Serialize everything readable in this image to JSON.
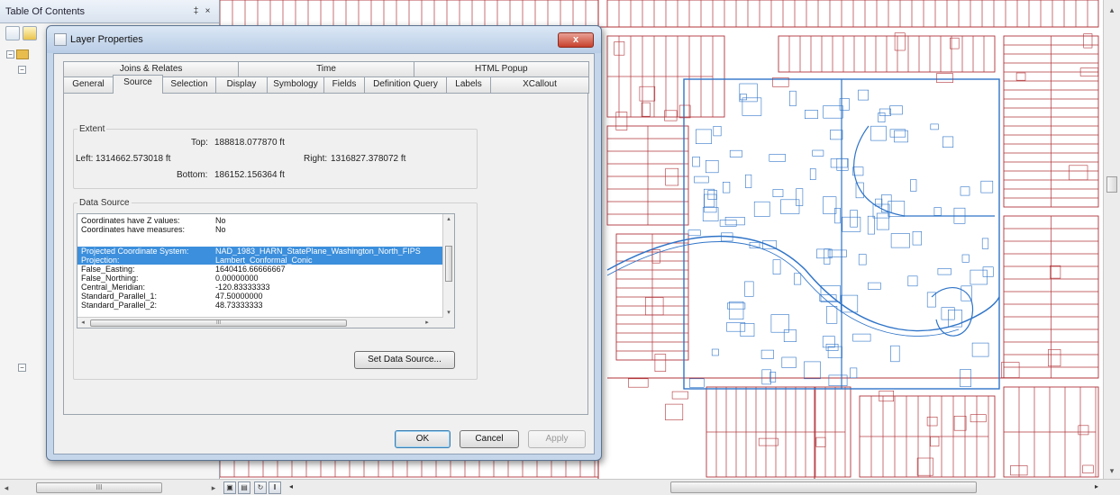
{
  "toc": {
    "title": "Table Of Contents",
    "pin_glyph": "‡",
    "close_glyph": "×"
  },
  "dialog": {
    "title": "Layer Properties",
    "close_glyph": "x",
    "tabs_row1": [
      "Joins & Relates",
      "Time",
      "HTML Popup"
    ],
    "tabs_row2": [
      "General",
      "Source",
      "Selection",
      "Display",
      "Symbology",
      "Fields",
      "Definition Query",
      "Labels",
      "XCallout"
    ],
    "active_tab": "Source",
    "extent": {
      "legend": "Extent",
      "top_label": "Top:",
      "top_value": "188818.077870 ft",
      "left_label": "Left:",
      "left_value": "1314662.573018 ft",
      "right_label": "Right:",
      "right_value": "1316827.378072 ft",
      "bottom_label": "Bottom:",
      "bottom_value": "186152.156364 ft"
    },
    "data_source": {
      "legend": "Data Source",
      "rows": [
        {
          "key": "Coordinates have Z values:",
          "value": "No",
          "selected": false
        },
        {
          "key": "Coordinates have measures:",
          "value": "No",
          "selected": false
        },
        {
          "key": "",
          "value": "",
          "selected": false
        },
        {
          "key": "Projected Coordinate System:",
          "value": "NAD_1983_HARN_StatePlane_Washington_North_FIPS",
          "selected": true
        },
        {
          "key": "Projection:",
          "value": "Lambert_Conformal_Conic",
          "selected": true
        },
        {
          "key": "False_Easting:",
          "value": "1640416.66666667",
          "selected": false
        },
        {
          "key": "False_Northing:",
          "value": "0.00000000",
          "selected": false
        },
        {
          "key": "Central_Meridian:",
          "value": "-120.83333333",
          "selected": false
        },
        {
          "key": "Standard_Parallel_1:",
          "value": "47.50000000",
          "selected": false
        },
        {
          "key": "Standard_Parallel_2:",
          "value": "48.73333333",
          "selected": false
        }
      ],
      "hscroll_grip": "III",
      "set_data_source_label": "Set Data Source..."
    },
    "buttons": {
      "ok": "OK",
      "cancel": "Cancel",
      "apply": "Apply"
    }
  },
  "scroll": {
    "toc_grip": "III",
    "left_arrow": "◂",
    "right_arrow": "▸",
    "up_arrow": "▴",
    "down_arrow": "▾"
  },
  "colors": {
    "parcel_lines": "#b0343a",
    "selected_parcels": "#2f74c8",
    "selection_highlight": "#3c8fdc"
  }
}
